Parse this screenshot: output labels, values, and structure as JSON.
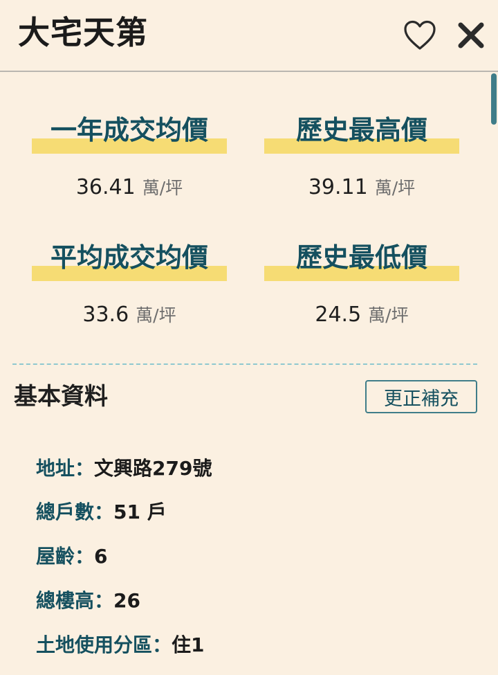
{
  "header": {
    "title": "大宅天第",
    "favorite_icon": "heart-outline-icon",
    "close_icon": "close-icon"
  },
  "stats": [
    {
      "label": "一年成交均價",
      "value": "36.41",
      "unit": "萬/坪"
    },
    {
      "label": "歷史最高價",
      "value": "39.11",
      "unit": "萬/坪"
    },
    {
      "label": "平均成交均價",
      "value": "33.6",
      "unit": "萬/坪"
    },
    {
      "label": "歷史最低價",
      "value": "24.5",
      "unit": "萬/坪"
    }
  ],
  "basic_info": {
    "title": "基本資料",
    "correct_button": "更正補充",
    "separator": "：",
    "items": [
      {
        "label": "地址",
        "value": "文興路279號"
      },
      {
        "label": "總戶數",
        "value": "51 戶"
      },
      {
        "label": "屋齡",
        "value": "6"
      },
      {
        "label": "總樓高",
        "value": "26"
      },
      {
        "label": "土地使用分區",
        "value": "住1"
      }
    ]
  },
  "colors": {
    "background": "#fbf0e1",
    "accent": "#15505f",
    "highlight": "#f6dc74",
    "divider": "#8ec8cf"
  }
}
